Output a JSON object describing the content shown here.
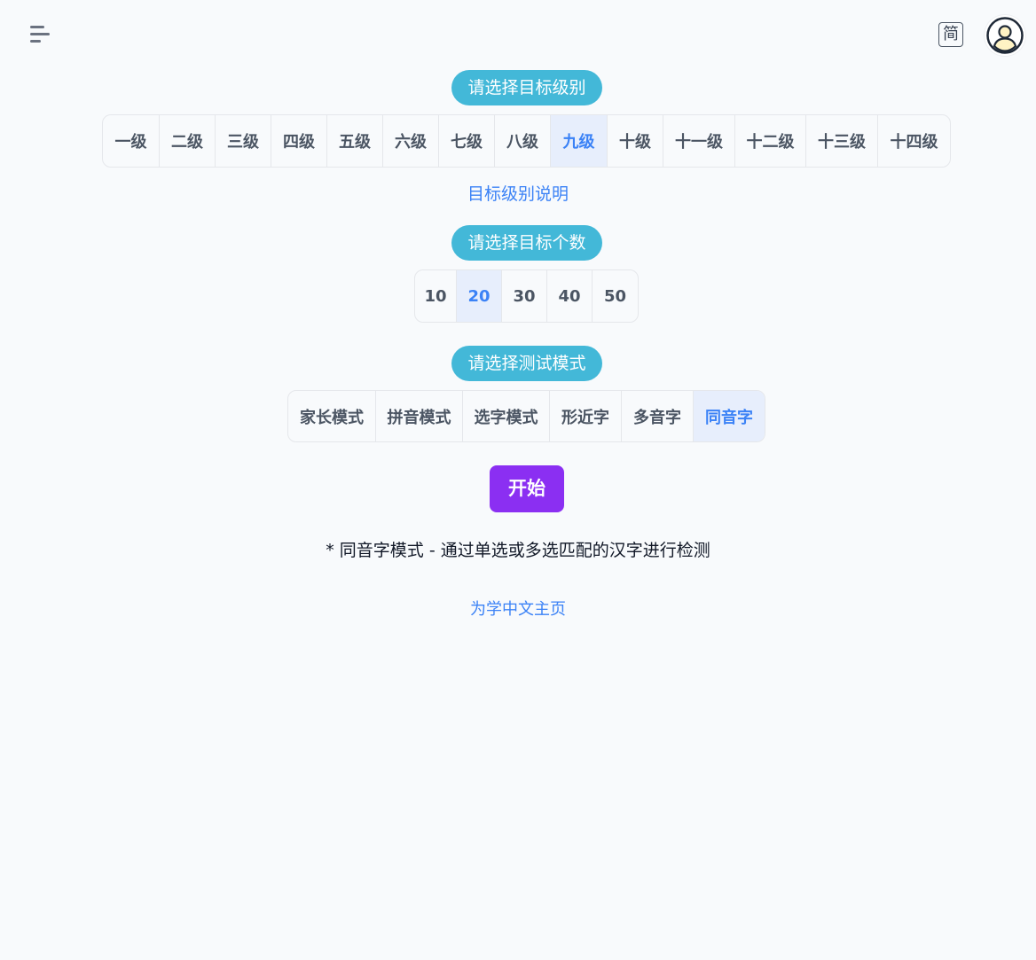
{
  "topbar": {
    "menu_icon": "hamburger-menu-icon",
    "lang_toggle": "简",
    "avatar_icon": "user-avatar-icon"
  },
  "level_section": {
    "title": "请选择目标级别",
    "options": [
      "一级",
      "二级",
      "三级",
      "四级",
      "五级",
      "六级",
      "七级",
      "八级",
      "九级",
      "十级",
      "十一级",
      "十二级",
      "十三级",
      "十四级"
    ],
    "selected": "九级",
    "help_link": "目标级别说明"
  },
  "count_section": {
    "title": "请选择目标个数",
    "options": [
      "10",
      "20",
      "30",
      "40",
      "50"
    ],
    "selected": "20"
  },
  "mode_section": {
    "title": "请选择测试模式",
    "options": [
      "家长模式",
      "拼音模式",
      "选字模式",
      "形近字",
      "多音字",
      "同音字"
    ],
    "selected": "同音字"
  },
  "start_button": "开始",
  "mode_description": "* 同音字模式 - 通过单选或多选匹配的汉字进行检测",
  "footer_link": "为学中文主页",
  "colors": {
    "pill": "#43b8d8",
    "accent": "#3b82f6",
    "start": "#8b2ff2"
  }
}
